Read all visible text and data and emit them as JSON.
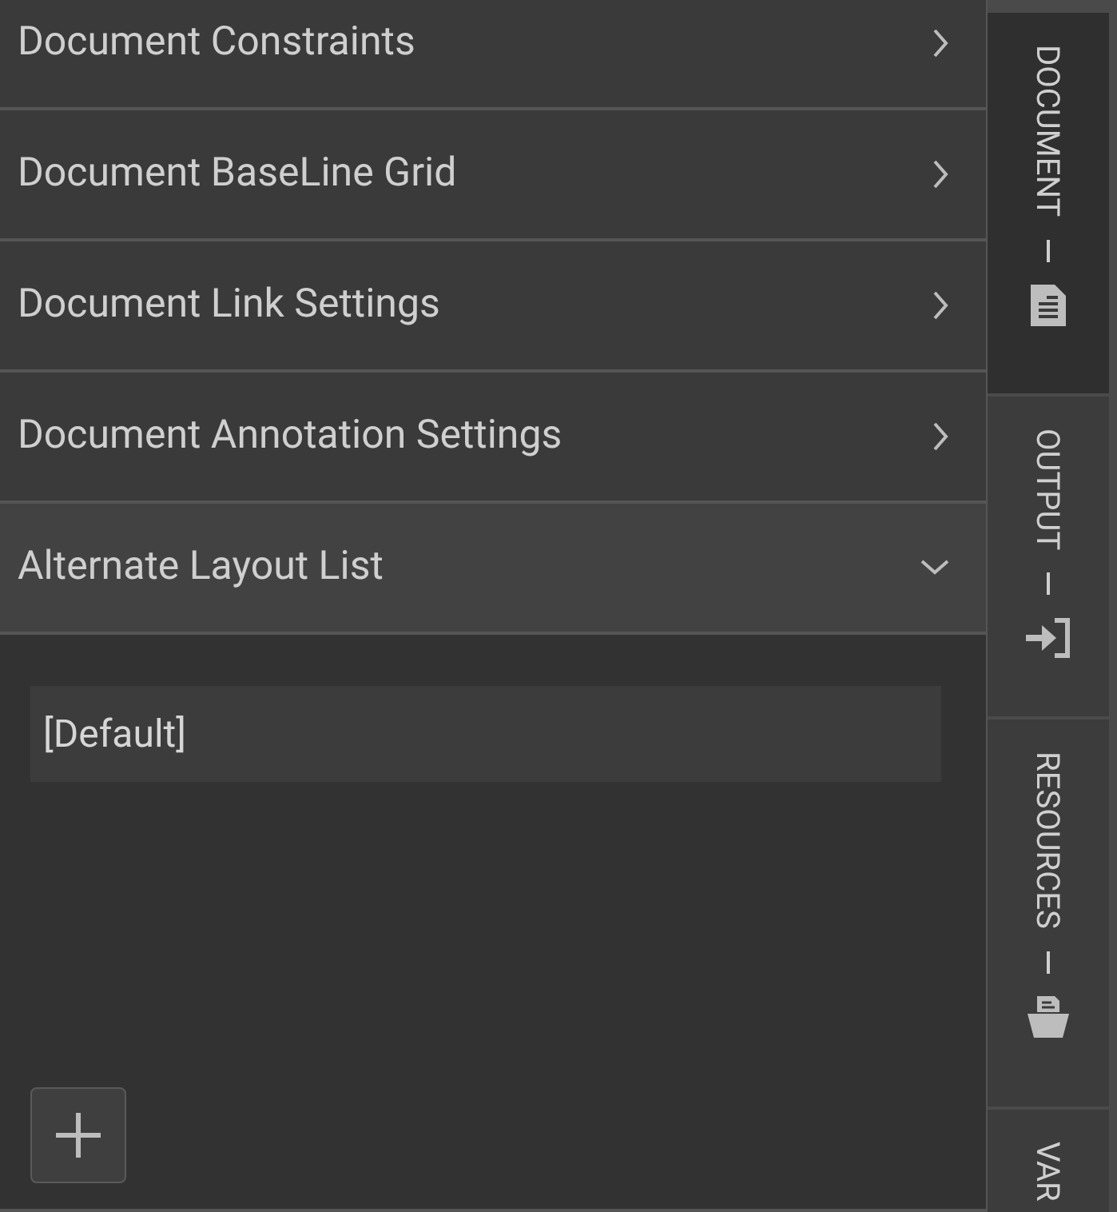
{
  "sections": [
    {
      "title": "Document Constraints",
      "expanded": false
    },
    {
      "title": "Document BaseLine Grid",
      "expanded": false
    },
    {
      "title": "Document Link Settings",
      "expanded": false
    },
    {
      "title": "Document Annotation Settings",
      "expanded": false
    },
    {
      "title": "Alternate Layout List",
      "expanded": true,
      "items": [
        "[Default]"
      ]
    }
  ],
  "side_tabs": [
    {
      "label": "DOCUMENT",
      "kind": "document",
      "selected": true
    },
    {
      "label": "OUTPUT",
      "kind": "export",
      "selected": false
    },
    {
      "label": "RESOURCES",
      "kind": "folder",
      "selected": false
    },
    {
      "label": "VAR",
      "selected": false
    }
  ]
}
